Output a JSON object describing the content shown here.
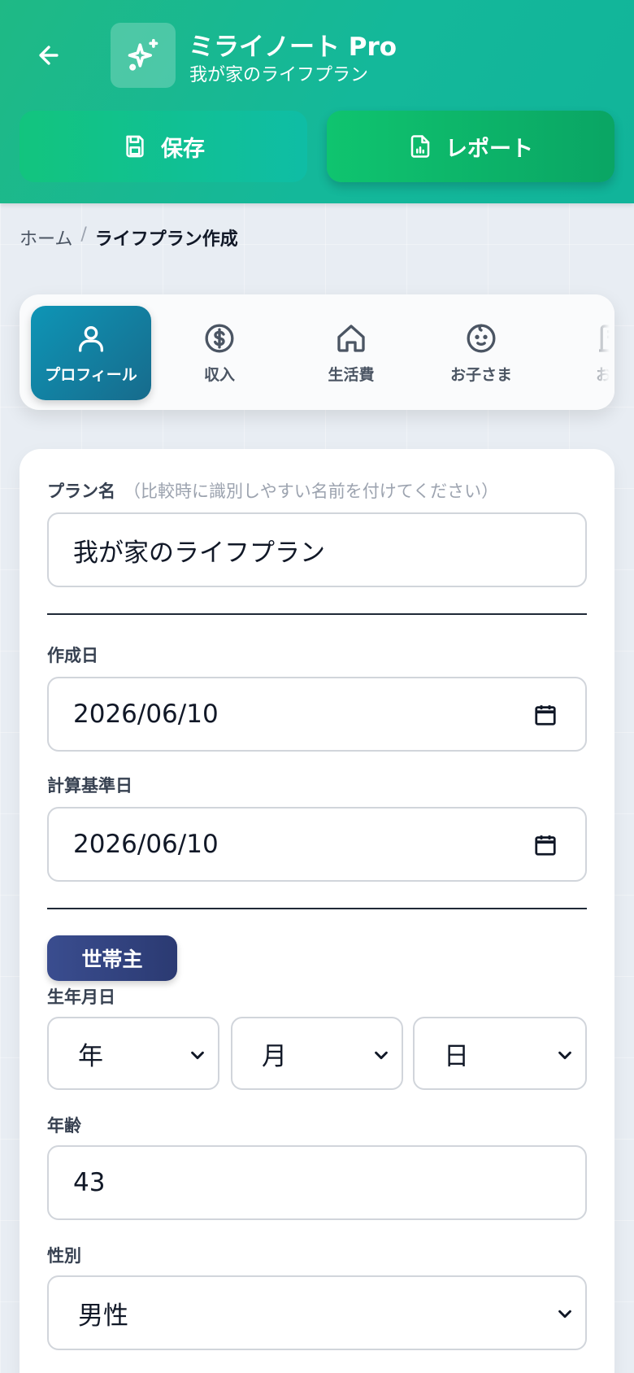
{
  "header": {
    "title": "ミライノート Pro",
    "subtitle": "我が家のライフプラン",
    "save_label": "保存",
    "report_label": "レポート",
    "icons": [
      "back-arrow-icon",
      "sparkles-icon",
      "save-icon",
      "report-icon"
    ]
  },
  "breadcrumb": {
    "home": "ホーム",
    "separator": "/",
    "current": "ライフプラン作成"
  },
  "tabs": [
    {
      "label": "プロフィール",
      "icon": "user-icon",
      "active": true
    },
    {
      "label": "収入",
      "icon": "dollar-icon",
      "active": false
    },
    {
      "label": "生活費",
      "icon": "home-icon",
      "active": false
    },
    {
      "label": "お子さま",
      "icon": "baby-icon",
      "active": false
    },
    {
      "label": "お住",
      "icon": "building-icon",
      "active": false
    }
  ],
  "form": {
    "plan_name_label": "プラン名",
    "plan_name_hint": "（比較時に識別しやすい名前を付けてください）",
    "plan_name_value": "我が家のライフプラン",
    "created_label": "作成日",
    "created_value": "2026/06/10",
    "base_date_label": "計算基準日",
    "base_date_value": "2026/06/10",
    "section_badge": "世帯主",
    "birthdate_label": "生年月日",
    "birth_year": "年",
    "birth_month": "月",
    "birth_day": "日",
    "age_label": "年齢",
    "age_value": "43",
    "gender_label": "性別",
    "gender_value": "男性"
  },
  "colors": {
    "header_green": "#14b89a",
    "active_tab": "#0e95b6",
    "badge_navy": "#2f3f7d"
  }
}
